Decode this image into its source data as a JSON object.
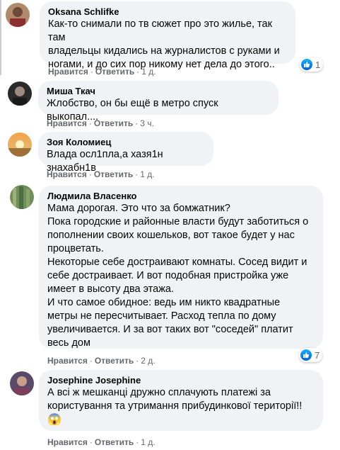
{
  "labels": {
    "like": "Нравится",
    "reply": "Ответить",
    "dot": "·"
  },
  "comments": [
    {
      "author": "Oksana Schlifke",
      "text": "Как-то снимали по тв сюжет про это жилье, так там\nвладельцы кидались на журналистов с руками и\nногами, и до сих пор никому нет дела до этого..",
      "time": "1 д.",
      "reactions": "1"
    },
    {
      "author": "Миша Ткач",
      "text": "Жлобство, он бы ещё в метро спуск выкопал....",
      "time": "3 ч."
    },
    {
      "author": "Зоя Коломиец",
      "text": "Влада осл1пла,а хазя1н знахабн1в",
      "time": "1 д."
    },
    {
      "author": "Людмила Власенко",
      "text": "Мама дорогая. Это что за бомжатник?\nПока городские и районные власти будут заботиться о\nпополнении своих кошельков, вот такое будет у нас\nпроцветать.\nНекоторые себе достраивают комнаты. Сосед видит и\nсебе достраивает. И вот подобная пристройка уже\nимеет в высоту два этажа.\nИ что самое обидное: ведь им никто квадратные\nметры не пересчитывает. Расход тепла по дому\nувеличивается. И за вот таких вот \"соседей\" платит\nвесь дом",
      "time": "2 д.",
      "reactions": "7"
    },
    {
      "author": "Josephine Josephine",
      "text": "А всі ж мешканці дружно сплачують платежі за\nкористування та утримання прибудинкової території!!",
      "emoji": "😱",
      "time": "1 д."
    }
  ],
  "colors": {
    "bubble": "#f0f2f5",
    "meta": "#65676b",
    "like_blue": "#1877f2"
  },
  "icons": {
    "like": "like-thumb-icon",
    "shocked": "screaming-face-emoji"
  }
}
